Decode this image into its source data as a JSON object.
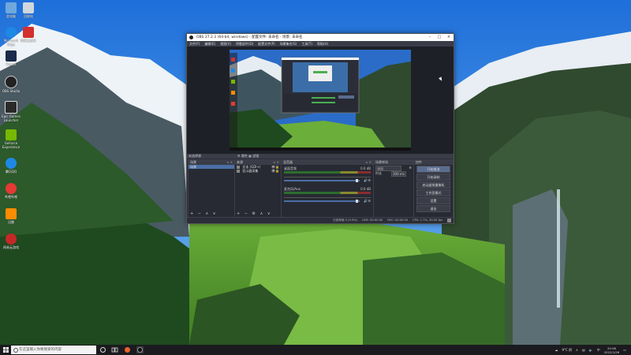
{
  "desktop": {
    "icons": [
      {
        "label": "此电脑",
        "color": "#6fa8dc",
        "icon": "computer-icon"
      },
      {
        "label": "回收站",
        "color": "#cfd8dc",
        "icon": "recycle-bin-icon"
      },
      {
        "label": "Microsoft Edge",
        "color": "#1e88e5",
        "icon": "edge-icon"
      },
      {
        "label": "网易云音乐",
        "color": "#d32f2f",
        "icon": "music-icon"
      },
      {
        "label": "Steam",
        "color": "#1a2a4a",
        "icon": "steam-icon"
      },
      {
        "label": "OBS Studio",
        "color": "#222222",
        "icon": "obs-icon"
      },
      {
        "label": "Epic Games Launcher",
        "color": "#2b2b2b",
        "icon": "epic-icon"
      },
      {
        "label": "GeForce Experience",
        "color": "#76b900",
        "icon": "geforce-icon"
      },
      {
        "label": "腾讯QQ",
        "color": "#1e88e5",
        "icon": "qq-icon"
      },
      {
        "label": "哔哩哔哩",
        "color": "#e53935",
        "icon": "bilibili-icon"
      },
      {
        "label": "迅雷",
        "color": "#fb8c00",
        "icon": "xunlei-icon"
      },
      {
        "label": "网易云游戏",
        "color": "#c62828",
        "icon": "game-icon"
      }
    ]
  },
  "obs": {
    "title": "OBS 27.2.3 (64-bit, windows) - 配置文件: 未命名 - 场景: 未命名",
    "menu": [
      "文件(F)",
      "编辑(E)",
      "视图(V)",
      "停靠部件(D)",
      "配置文件(P)",
      "场景集合(S)",
      "工具(T)",
      "帮助(H)"
    ],
    "scene_bar_label": "未选择源",
    "scene_bar_controls": "⚙ 属性  ▦ 滤镜",
    "scenes": {
      "title": "场景",
      "items": [
        "场景"
      ]
    },
    "sources": {
      "title": "来源",
      "items": [
        "文本 (GDI+)",
        "显示器采集"
      ]
    },
    "mixer": {
      "title": "混音器",
      "tracks": [
        {
          "name": "桌面音频",
          "db": "0.0 dB"
        },
        {
          "name": "麦克风/Aux",
          "db": "0.0 dB"
        }
      ]
    },
    "transitions": {
      "title": "场景转场",
      "type": "淡出",
      "duration_label": "时长",
      "duration": "300 ms"
    },
    "controls": {
      "title": "控件",
      "buttons": [
        "开始推流",
        "开始录制",
        "启动虚拟摄像机",
        "工作室模式",
        "设置",
        "退出"
      ]
    },
    "status": {
      "live": "LIVE: 00:00:00",
      "rec": "REC: 00:00:00",
      "cpu": "CPU: 1.7%, 30.00 fps",
      "drop": "已丢弃帧 0 (0.0%)"
    }
  },
  "taskbar": {
    "search_placeholder": "在这里输入你要搜索的内容",
    "weather": "9°C 阴",
    "lang": "中",
    "time": "20:06",
    "date": "2022/1/26"
  }
}
